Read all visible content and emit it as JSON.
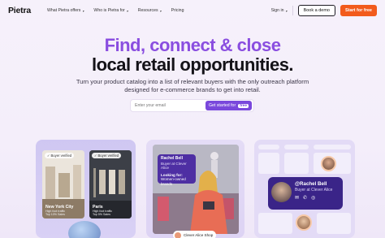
{
  "nav": {
    "logo": "Pietra",
    "links": [
      "What Pietra offers",
      "Who is Pietra for",
      "Resources",
      "Pricing"
    ],
    "sign_in": "Sign in",
    "book_demo": "Book a demo",
    "start_free": "Start for free"
  },
  "hero": {
    "title_line1": "Find, connect & close",
    "title_line2": "local retail opportunities.",
    "subtitle_line1": "Turn your product catalog into a list of relevant buyers with the only outreach platform",
    "subtitle_line2": "designed for e-commerce brands to get into retail."
  },
  "signup": {
    "email_placeholder": "Enter your email",
    "button_label": "Get started for",
    "button_badge": "free"
  },
  "stores": [
    {
      "badge": "Buyer verified",
      "city": "New York City",
      "meta1": "High foot traffic",
      "meta2": "Top 10% Sales"
    },
    {
      "badge": "Buyer verified",
      "city": "Paris",
      "meta1": "High foot traffic",
      "meta2": "Top 5% Sales"
    }
  ],
  "buyer_bubble": {
    "name": "Rachel Bell",
    "role": "Buyer at Clever Alice",
    "looking_label": "Looking for:",
    "looking_value": "Women-owned brands"
  },
  "shop_bar": {
    "label": "Clever Alice Shop"
  },
  "profile_card": {
    "name": "@Rachel Bell",
    "role": "Buyer at Clever Alice"
  },
  "colors": {
    "accent": "#8a4ee0",
    "cta": "#f25b1c",
    "button": "#7a48dc"
  }
}
